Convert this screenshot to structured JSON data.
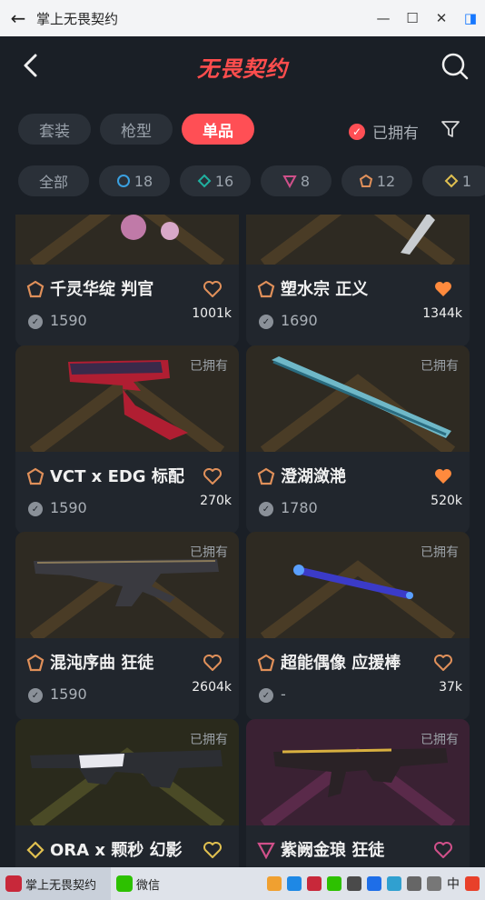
{
  "window": {
    "title": "掌上无畏契约"
  },
  "header": {
    "logo": "无畏契约"
  },
  "tabs": [
    {
      "label": "套装",
      "active": false
    },
    {
      "label": "枪型",
      "active": false
    },
    {
      "label": "单品",
      "active": true
    }
  ],
  "owned_filter": {
    "label": "已拥有",
    "checked": true
  },
  "tiers": [
    {
      "label": "全部",
      "icon": ""
    },
    {
      "label": "18",
      "icon": "select-tier-icon",
      "color": "#3aa0e0"
    },
    {
      "label": "16",
      "icon": "deluxe-tier-icon",
      "color": "#20b0a0"
    },
    {
      "label": "8",
      "icon": "premium-tier-icon",
      "color": "#d0508a"
    },
    {
      "label": "12",
      "icon": "exclusive-tier-icon",
      "color": "#e0905a"
    },
    {
      "label": "1",
      "icon": "ultra-tier-icon",
      "color": "#e0c050"
    }
  ],
  "items": [
    {
      "name": "千灵华绽 判官",
      "price": "1590",
      "likes": "1001k",
      "owned_label": "",
      "liked": false,
      "tier_color": "#e0905a"
    },
    {
      "name": "塑水宗 正义",
      "price": "1690",
      "likes": "1344k",
      "owned_label": "",
      "liked": true,
      "tier_color": "#e0905a"
    },
    {
      "name": "VCT x EDG 标配",
      "price": "1590",
      "likes": "270k",
      "owned_label": "已拥有",
      "liked": false,
      "tier_color": "#e0905a"
    },
    {
      "name": "澄湖潋滟",
      "price": "1780",
      "likes": "520k",
      "owned_label": "已拥有",
      "liked": true,
      "tier_color": "#e0905a"
    },
    {
      "name": "混沌序曲 狂徒",
      "price": "1590",
      "likes": "2604k",
      "owned_label": "已拥有",
      "liked": false,
      "tier_color": "#e0905a"
    },
    {
      "name": "超能偶像 应援棒",
      "price": "-",
      "likes": "37k",
      "owned_label": "已拥有",
      "liked": false,
      "tier_color": "#e0905a"
    },
    {
      "name": "ORA x 颗秒 幻影",
      "price": "",
      "likes": "",
      "owned_label": "已拥有",
      "liked": false,
      "tier_color": "#e0c050"
    },
    {
      "name": "紫阙金琅 狂徒",
      "price": "",
      "likes": "",
      "owned_label": "已拥有",
      "liked": false,
      "tier_color": "#d0508a"
    }
  ],
  "taskbar": {
    "apps": [
      {
        "label": "掌上无畏契约"
      },
      {
        "label": "微信"
      }
    ],
    "ime": "中"
  },
  "colors": {
    "accent": "#ff4f55",
    "background": "#1a1f26",
    "heart_active": "#ff8a3d",
    "heart_outline": "#e0905a"
  }
}
